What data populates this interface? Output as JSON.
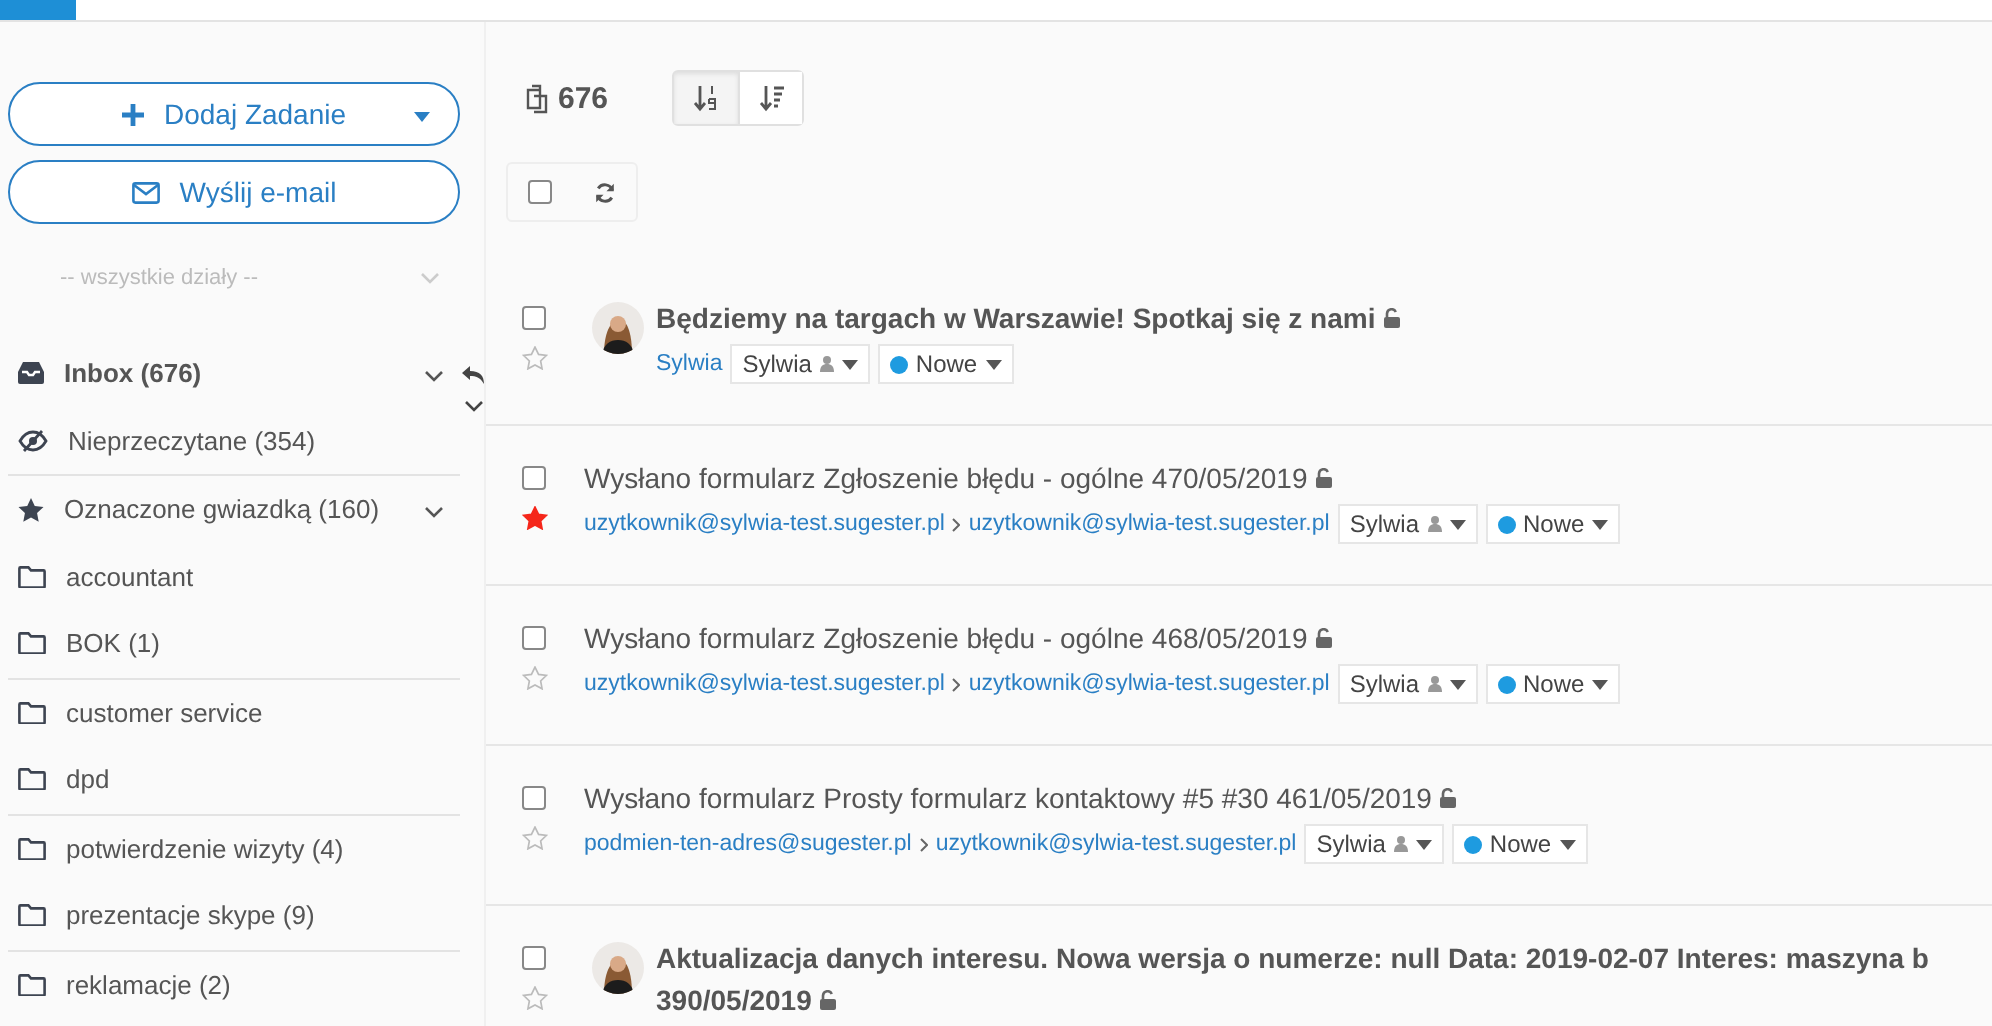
{
  "sidebar": {
    "add_button": "Dodaj Zadanie",
    "email_button": "Wyślij e-mail",
    "department_select": {
      "placeholder": "-- wszystkie działy --"
    },
    "sections": [
      [
        {
          "kind": "inbox",
          "label": "Inbox (676)",
          "expandable": true
        },
        {
          "kind": "unread",
          "label": "Nieprzeczytane (354)",
          "expandable": false
        }
      ],
      [
        {
          "kind": "starred",
          "label": "Oznaczone gwiazdką (160)",
          "expandable": true
        },
        {
          "kind": "folder",
          "label": "accountant",
          "expandable": false
        },
        {
          "kind": "folder",
          "label": "BOK (1)",
          "expandable": false
        }
      ],
      [
        {
          "kind": "folder",
          "label": "customer service",
          "expandable": false
        },
        {
          "kind": "folder",
          "label": "dpd",
          "expandable": false
        }
      ],
      [
        {
          "kind": "folder",
          "label": "potwierdzenie wizyty (4)",
          "expandable": false
        },
        {
          "kind": "folder",
          "label": "prezentacje skype (9)",
          "expandable": false
        }
      ],
      [
        {
          "kind": "folder",
          "label": "reklamacje (2)",
          "expandable": false
        }
      ]
    ]
  },
  "main": {
    "count": "676",
    "select_all_checked": false,
    "sort_buttons": [
      {
        "kind": "numeric",
        "selected": true
      },
      {
        "kind": "list",
        "selected": false
      }
    ],
    "messages": [
      {
        "subject_lines": [
          "Będziemy na targach w Warszawie! Spotkaj się z nami"
        ],
        "unread": true,
        "avatar": true,
        "starred": false,
        "checked": false,
        "from": "Sylwia",
        "owner": "Sylwia",
        "status": {
          "label": "Nowe",
          "color": "#1e9be0"
        }
      },
      {
        "subject_lines": [
          "Wysłano formularz Zgłoszenie błędu - ogólne 470/05/2019"
        ],
        "unread": false,
        "avatar": false,
        "starred": true,
        "checked": false,
        "from": "uzytkownik@sylwia-test.sugester.pl",
        "to": "uzytkownik@sylwia-test.sugester.pl",
        "owner": "Sylwia",
        "status": {
          "label": "Nowe",
          "color": "#1e9be0"
        }
      },
      {
        "subject_lines": [
          "Wysłano formularz Zgłoszenie błędu - ogólne 468/05/2019"
        ],
        "unread": false,
        "avatar": false,
        "starred": false,
        "checked": false,
        "from": "uzytkownik@sylwia-test.sugester.pl",
        "to": "uzytkownik@sylwia-test.sugester.pl",
        "owner": "Sylwia",
        "status": {
          "label": "Nowe",
          "color": "#1e9be0"
        }
      },
      {
        "subject_lines": [
          "Wysłano formularz Prosty formularz kontaktowy #5 #30 461/05/2019"
        ],
        "unread": false,
        "avatar": false,
        "starred": false,
        "checked": false,
        "from": "podmien-ten-adres@sugester.pl",
        "to": "uzytkownik@sylwia-test.sugester.pl",
        "owner": "Sylwia",
        "status": {
          "label": "Nowe",
          "color": "#1e9be0"
        }
      },
      {
        "subject_lines": [
          "Aktualizacja danych interesu. Nowa wersja o numerze: null Data: 2019-02-07 Interes: maszyna b",
          "390/05/2019"
        ],
        "unread": true,
        "avatar": true,
        "starred": false,
        "checked": false
      }
    ]
  }
}
